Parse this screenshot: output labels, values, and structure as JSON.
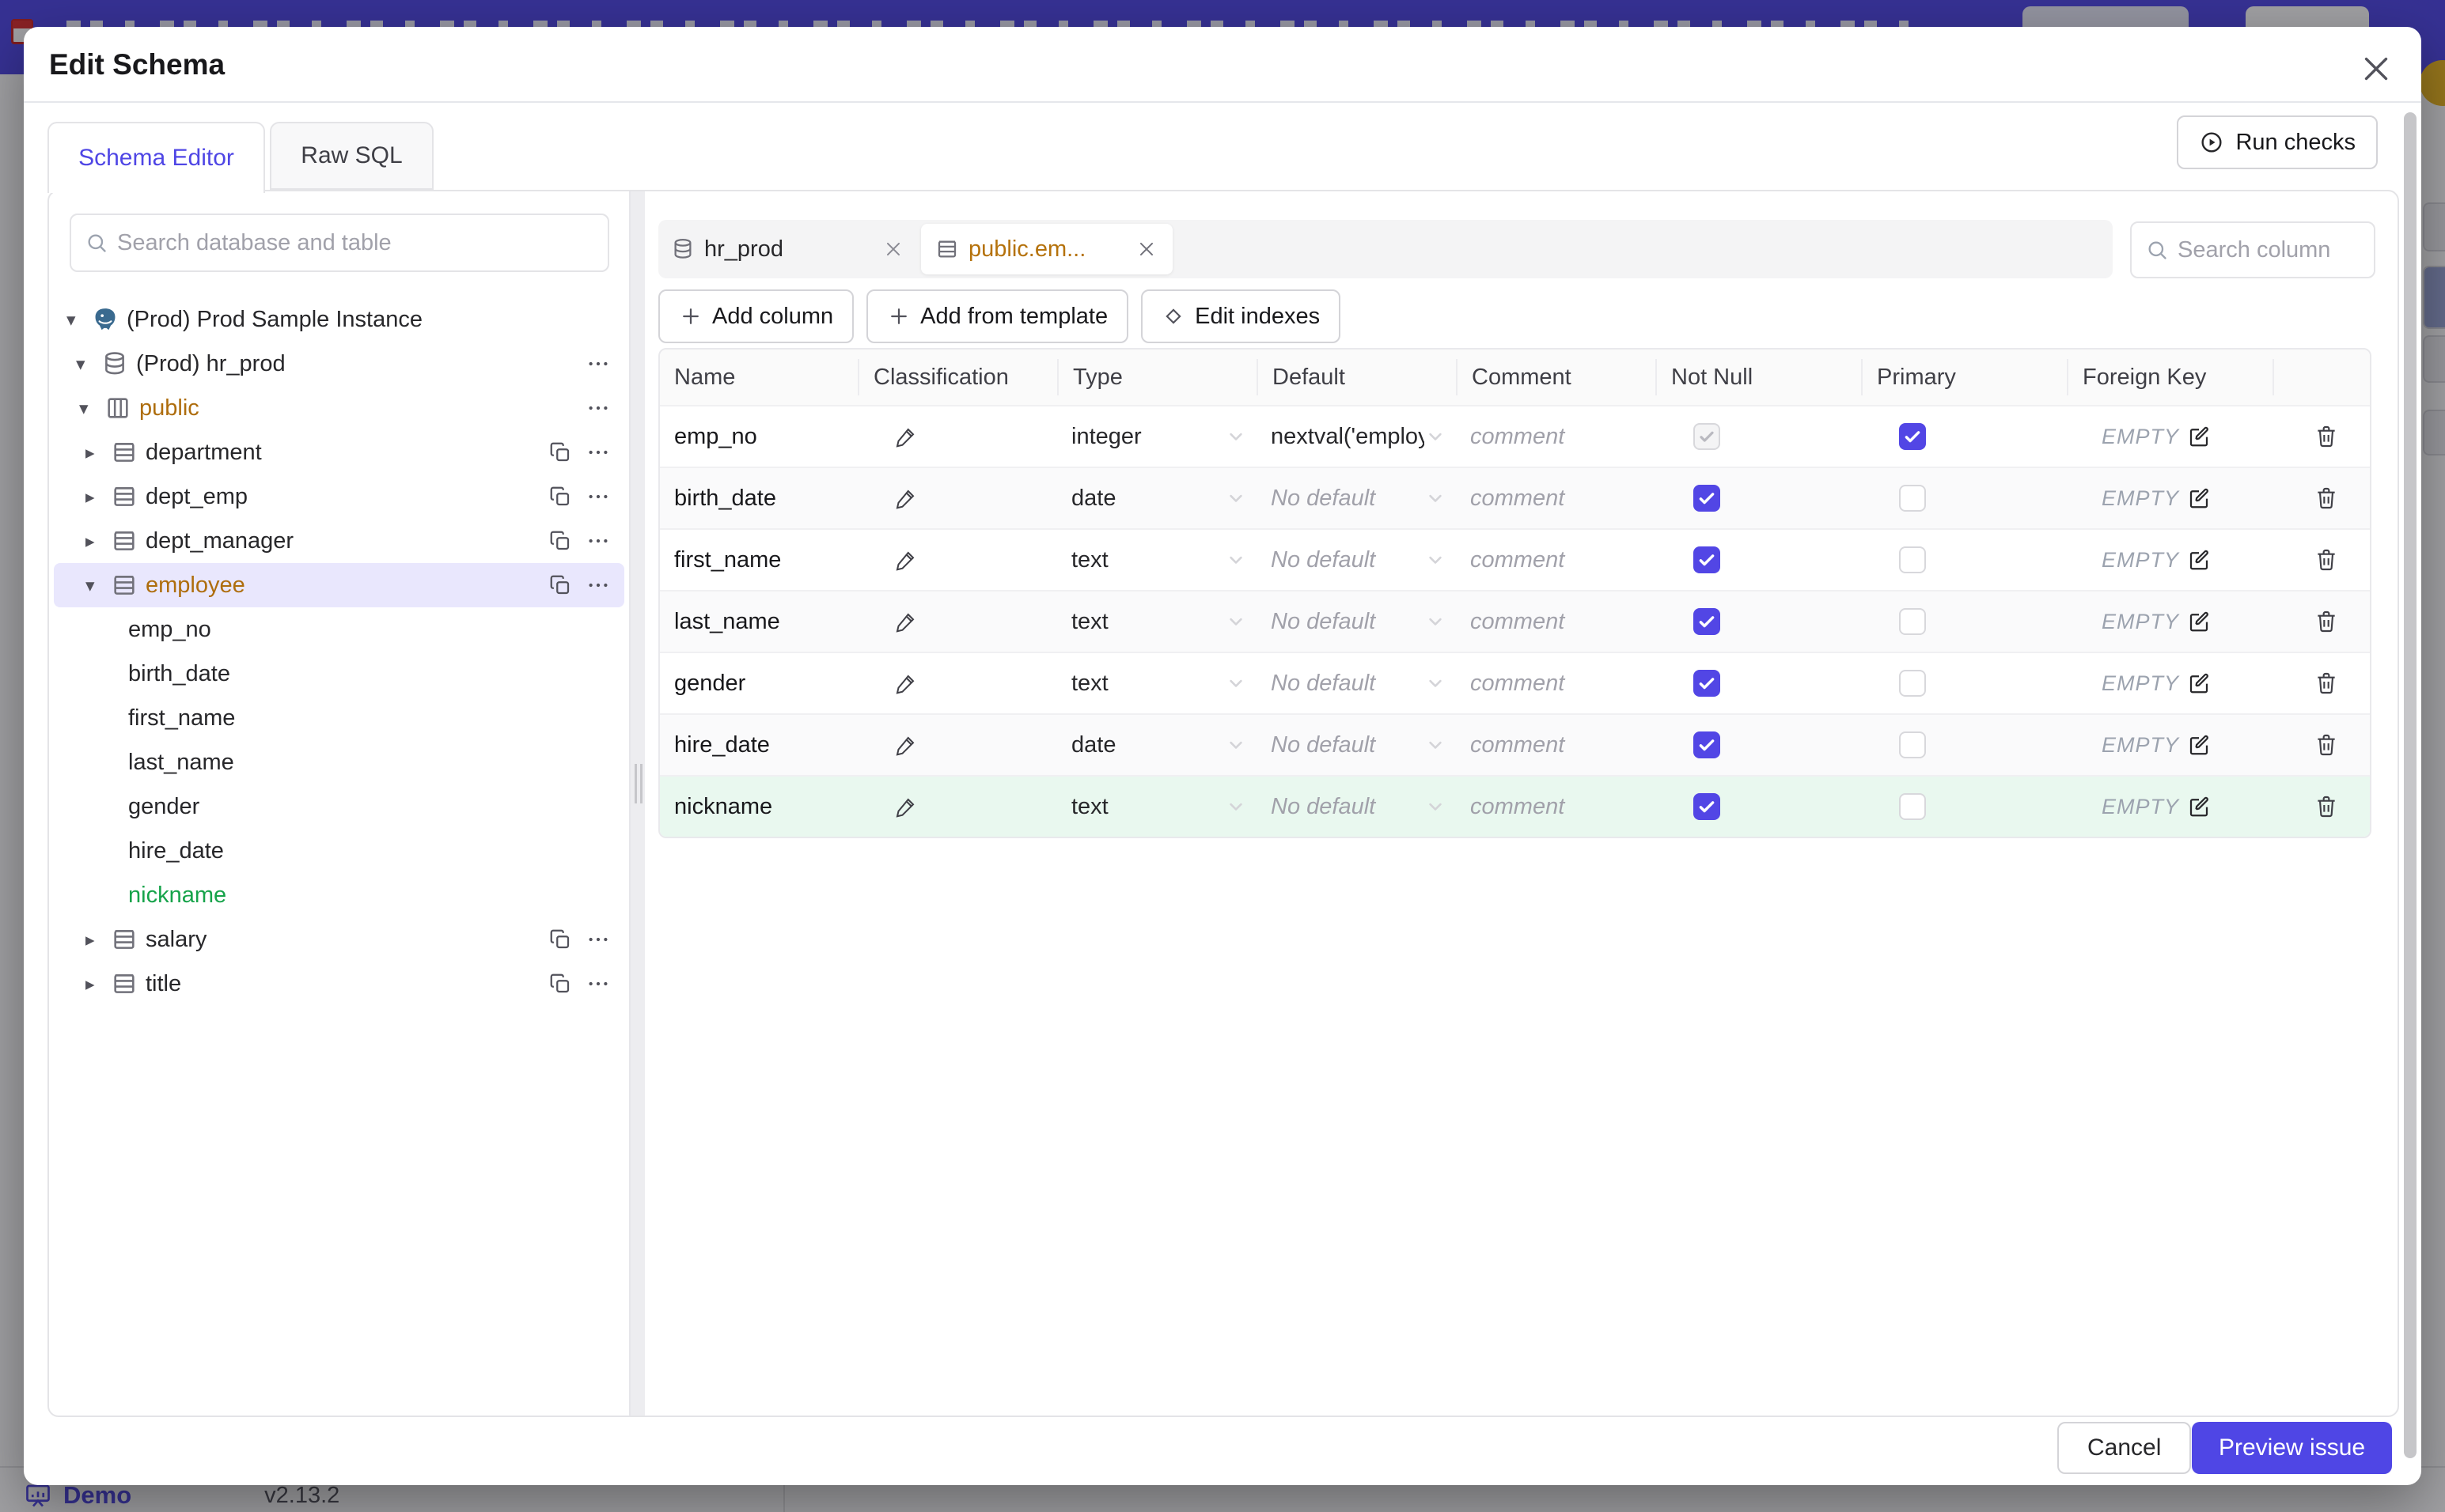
{
  "page": {
    "footer": {
      "brand": "Demo",
      "version": "v2.13.2"
    }
  },
  "modal": {
    "title": "Edit Schema",
    "main_tabs": [
      {
        "label": "Schema Editor",
        "active": true
      },
      {
        "label": "Raw SQL",
        "active": false
      }
    ],
    "run_checks_label": "Run checks",
    "sidebar": {
      "search_placeholder": "Search database and table",
      "tree": [
        {
          "level": 0,
          "caret": "down",
          "icon": "postgres",
          "label": "(Prod) Prod Sample Instance",
          "color": "default",
          "actions": []
        },
        {
          "level": 1,
          "caret": "down",
          "icon": "database",
          "label": "(Prod) hr_prod",
          "color": "default",
          "actions": [
            "menu"
          ]
        },
        {
          "level": 2,
          "caret": "down",
          "icon": "schema",
          "label": "public",
          "color": "amber",
          "actions": [
            "menu"
          ]
        },
        {
          "level": 3,
          "caret": "right",
          "icon": "table",
          "label": "department",
          "color": "default",
          "actions": [
            "copy",
            "menu"
          ]
        },
        {
          "level": 3,
          "caret": "right",
          "icon": "table",
          "label": "dept_emp",
          "color": "default",
          "actions": [
            "copy",
            "menu"
          ]
        },
        {
          "level": 3,
          "caret": "right",
          "icon": "table",
          "label": "dept_manager",
          "color": "default",
          "actions": [
            "copy",
            "menu"
          ]
        },
        {
          "level": 3,
          "caret": "down",
          "icon": "table",
          "label": "employee",
          "color": "amber",
          "selected": true,
          "actions": [
            "copy",
            "menu"
          ]
        },
        {
          "level": 4,
          "caret": "",
          "icon": "",
          "label": "emp_no",
          "color": "default",
          "actions": []
        },
        {
          "level": 4,
          "caret": "",
          "icon": "",
          "label": "birth_date",
          "color": "default",
          "actions": []
        },
        {
          "level": 4,
          "caret": "",
          "icon": "",
          "label": "first_name",
          "color": "default",
          "actions": []
        },
        {
          "level": 4,
          "caret": "",
          "icon": "",
          "label": "last_name",
          "color": "default",
          "actions": []
        },
        {
          "level": 4,
          "caret": "",
          "icon": "",
          "label": "gender",
          "color": "default",
          "actions": []
        },
        {
          "level": 4,
          "caret": "",
          "icon": "",
          "label": "hire_date",
          "color": "default",
          "actions": []
        },
        {
          "level": 4,
          "caret": "",
          "icon": "",
          "label": "nickname",
          "color": "green",
          "actions": []
        },
        {
          "level": 3,
          "caret": "right",
          "icon": "table",
          "label": "salary",
          "color": "default",
          "actions": [
            "copy",
            "menu"
          ]
        },
        {
          "level": 3,
          "caret": "right",
          "icon": "table",
          "label": "title",
          "color": "default",
          "actions": [
            "copy",
            "menu"
          ]
        }
      ]
    },
    "editor": {
      "open_tabs": [
        {
          "icon": "database",
          "label": "hr_prod",
          "active": false
        },
        {
          "icon": "table",
          "label": "public.em...",
          "active": true,
          "modified": true
        }
      ],
      "toolbar": [
        {
          "icon": "plus",
          "label": "Add column"
        },
        {
          "icon": "plus",
          "label": "Add from template"
        },
        {
          "icon": "diamond",
          "label": "Edit indexes"
        }
      ],
      "search_placeholder": "Search column",
      "table": {
        "headers": [
          "Name",
          "Classification",
          "Type",
          "Default",
          "Comment",
          "Not Null",
          "Primary",
          "Foreign Key"
        ],
        "comment_placeholder": "comment",
        "rows": [
          {
            "name": "emp_no",
            "type": "integer",
            "default": "nextval('employ",
            "default_placeholder": false,
            "not_null": "disabled-checked",
            "primary": "checked",
            "fk": "EMPTY",
            "state": "normal"
          },
          {
            "name": "birth_date",
            "type": "date",
            "default": "No default",
            "default_placeholder": true,
            "not_null": "checked",
            "primary": "unchecked",
            "fk": "EMPTY",
            "state": "normal"
          },
          {
            "name": "first_name",
            "type": "text",
            "default": "No default",
            "default_placeholder": true,
            "not_null": "checked",
            "primary": "unchecked",
            "fk": "EMPTY",
            "state": "normal"
          },
          {
            "name": "last_name",
            "type": "text",
            "default": "No default",
            "default_placeholder": true,
            "not_null": "checked",
            "primary": "unchecked",
            "fk": "EMPTY",
            "state": "normal"
          },
          {
            "name": "gender",
            "type": "text",
            "default": "No default",
            "default_placeholder": true,
            "not_null": "checked",
            "primary": "unchecked",
            "fk": "EMPTY",
            "state": "normal"
          },
          {
            "name": "hire_date",
            "type": "date",
            "default": "No default",
            "default_placeholder": true,
            "not_null": "checked",
            "primary": "unchecked",
            "fk": "EMPTY",
            "state": "normal"
          },
          {
            "name": "nickname",
            "type": "text",
            "default": "No default",
            "default_placeholder": true,
            "not_null": "checked",
            "primary": "unchecked",
            "fk": "EMPTY",
            "state": "new"
          }
        ]
      }
    },
    "footer": {
      "cancel_label": "Cancel",
      "submit_label": "Preview issue"
    }
  },
  "colors": {
    "accent": "#4f46e5",
    "banner": "#4f46e5",
    "modified_amber": "#ae6d0d",
    "new_green": "#16a34a",
    "selected_row_bg": "#e9e7fd",
    "new_row_bg": "#e9f8ef",
    "avatar_gold": "#edb81f"
  }
}
